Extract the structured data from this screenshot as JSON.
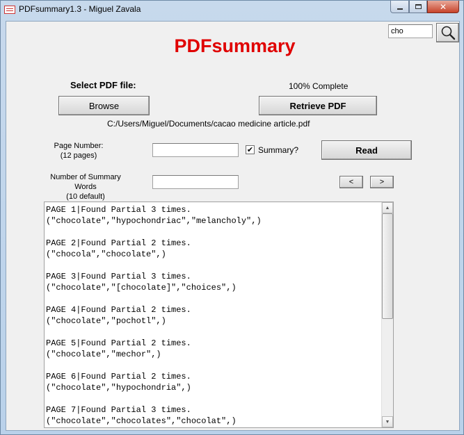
{
  "window": {
    "title": "PDFsummary1.3 - Miguel Zavala",
    "min_icon": "minimize-icon",
    "max_icon": "maximize-icon",
    "close_icon": "close-icon"
  },
  "search": {
    "value": "cho",
    "icon": "magnifier-icon",
    "glyph": "⚲"
  },
  "app": {
    "heading": "PDFsummary",
    "heading_color": "#e00000"
  },
  "file": {
    "select_label": "Select PDF file:",
    "browse_label": "Browse",
    "progress_text": "100% Complete",
    "retrieve_label": "Retrieve PDF",
    "path": "C:/Users/Miguel/Documents/cacao medicine article.pdf"
  },
  "page": {
    "label_line1": "Page Number:",
    "label_line2": "(12 pages)",
    "value": "",
    "summary_label": "Summary?",
    "summary_checked": true,
    "check_glyph": "✔",
    "read_label": "Read"
  },
  "summary_words": {
    "label_line1": "Number of Summary Words",
    "label_line2": "(10 default)",
    "value": "",
    "prev_label": "<",
    "next_label": ">"
  },
  "results": {
    "text": "PAGE 1|Found Partial 3 times.\n(\"chocolate\",\"hypochondriac\",\"melancholy\",)\n\nPAGE 2|Found Partial 2 times.\n(\"chocola\",\"chocolate\",)\n\nPAGE 3|Found Partial 3 times.\n(\"chocolate\",\"[chocolate]\",\"choices\",)\n\nPAGE 4|Found Partial 2 times.\n(\"chocolate\",\"pochotl\",)\n\nPAGE 5|Found Partial 2 times.\n(\"chocolate\",\"mechor\",)\n\nPAGE 6|Found Partial 2 times.\n(\"chocolate\",\"hypochondria\",)\n\nPAGE 7|Found Partial 3 times.\n(\"chocolate\",\"chocolates\",\"chocolat\",)",
    "scroll_up": "▲",
    "scroll_down": "▼"
  }
}
